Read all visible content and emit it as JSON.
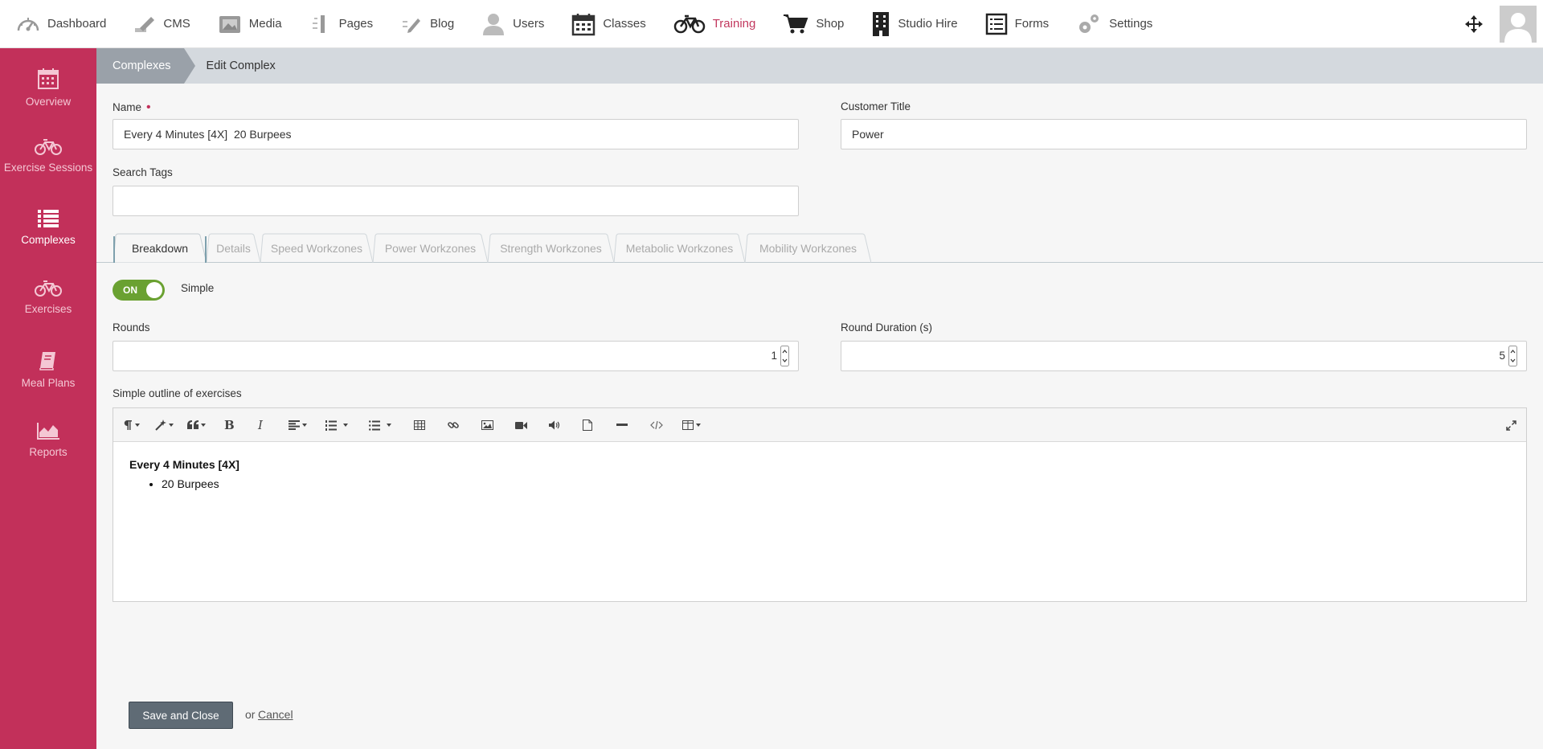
{
  "topnav": {
    "items": [
      {
        "label": "Dashboard",
        "icon": "gauge-icon"
      },
      {
        "label": "CMS",
        "icon": "pencil-icon"
      },
      {
        "label": "Media",
        "icon": "image-icon"
      },
      {
        "label": "Pages",
        "icon": "pages-icon"
      },
      {
        "label": "Blog",
        "icon": "blog-icon"
      },
      {
        "label": "Users",
        "icon": "user-icon"
      },
      {
        "label": "Classes",
        "icon": "calendar-icon"
      },
      {
        "label": "Training",
        "icon": "bicycle-icon"
      },
      {
        "label": "Shop",
        "icon": "cart-icon"
      },
      {
        "label": "Studio Hire",
        "icon": "building-icon"
      },
      {
        "label": "Forms",
        "icon": "form-icon"
      },
      {
        "label": "Settings",
        "icon": "gear-icon"
      }
    ],
    "active": "Training"
  },
  "sidebar": {
    "items": [
      {
        "label": "Overview",
        "icon": "calendar-icon"
      },
      {
        "label": "Exercise Sessions",
        "icon": "bicycle-icon"
      },
      {
        "label": "Complexes",
        "icon": "list-icon"
      },
      {
        "label": "Exercises",
        "icon": "bicycle-icon"
      },
      {
        "label": "Meal Plans",
        "icon": "book-icon"
      },
      {
        "label": "Reports",
        "icon": "area-chart-icon"
      }
    ],
    "active": "Complexes"
  },
  "breadcrumb": {
    "parent": "Complexes",
    "current": "Edit Complex"
  },
  "form": {
    "name_label": "Name",
    "required_marker": "•",
    "name_value": "Every 4 Minutes [4X]  20 Burpees",
    "customer_title_label": "Customer Title",
    "customer_title_value": "Power",
    "search_tags_label": "Search Tags",
    "search_tags_value": ""
  },
  "tabs": [
    {
      "label": "Breakdown",
      "active": true
    },
    {
      "label": "Details",
      "active": false
    },
    {
      "label": "Speed Workzones",
      "active": false
    },
    {
      "label": "Power Workzones",
      "active": false
    },
    {
      "label": "Strength Workzones",
      "active": false
    },
    {
      "label": "Metabolic Workzones",
      "active": false
    },
    {
      "label": "Mobility Workzones",
      "active": false
    }
  ],
  "breakdown": {
    "toggle_state": "ON",
    "toggle_label": "Simple",
    "rounds_label": "Rounds",
    "rounds_value": "1",
    "round_duration_label": "Round Duration (s)",
    "round_duration_value": "5",
    "outline_label": "Simple outline of exercises"
  },
  "editor": {
    "heading": "Every 4 Minutes [4X]",
    "items": [
      "20 Burpees"
    ],
    "toolbar": [
      "paragraph-style-icon",
      "magic-style-icon",
      "blockquote-icon",
      "bold-icon",
      "italic-icon",
      "align-icon",
      "ordered-list-icon",
      "unordered-list-icon",
      "table-icon",
      "link-icon",
      "image-icon",
      "video-icon",
      "audio-icon",
      "file-icon",
      "horizontal-rule-icon",
      "code-view-icon",
      "layout-icon",
      "fullscreen-icon"
    ],
    "bold_glyph": "B",
    "italic_glyph": "I"
  },
  "footer": {
    "save_label": "Save and Close",
    "or_text": "or",
    "cancel_label": "Cancel"
  },
  "colors": {
    "sidebar": "#c2305a",
    "accent": "#c2385e",
    "toggle_on": "#6aa131",
    "breadcrumb_bg": "#d4d9de"
  }
}
